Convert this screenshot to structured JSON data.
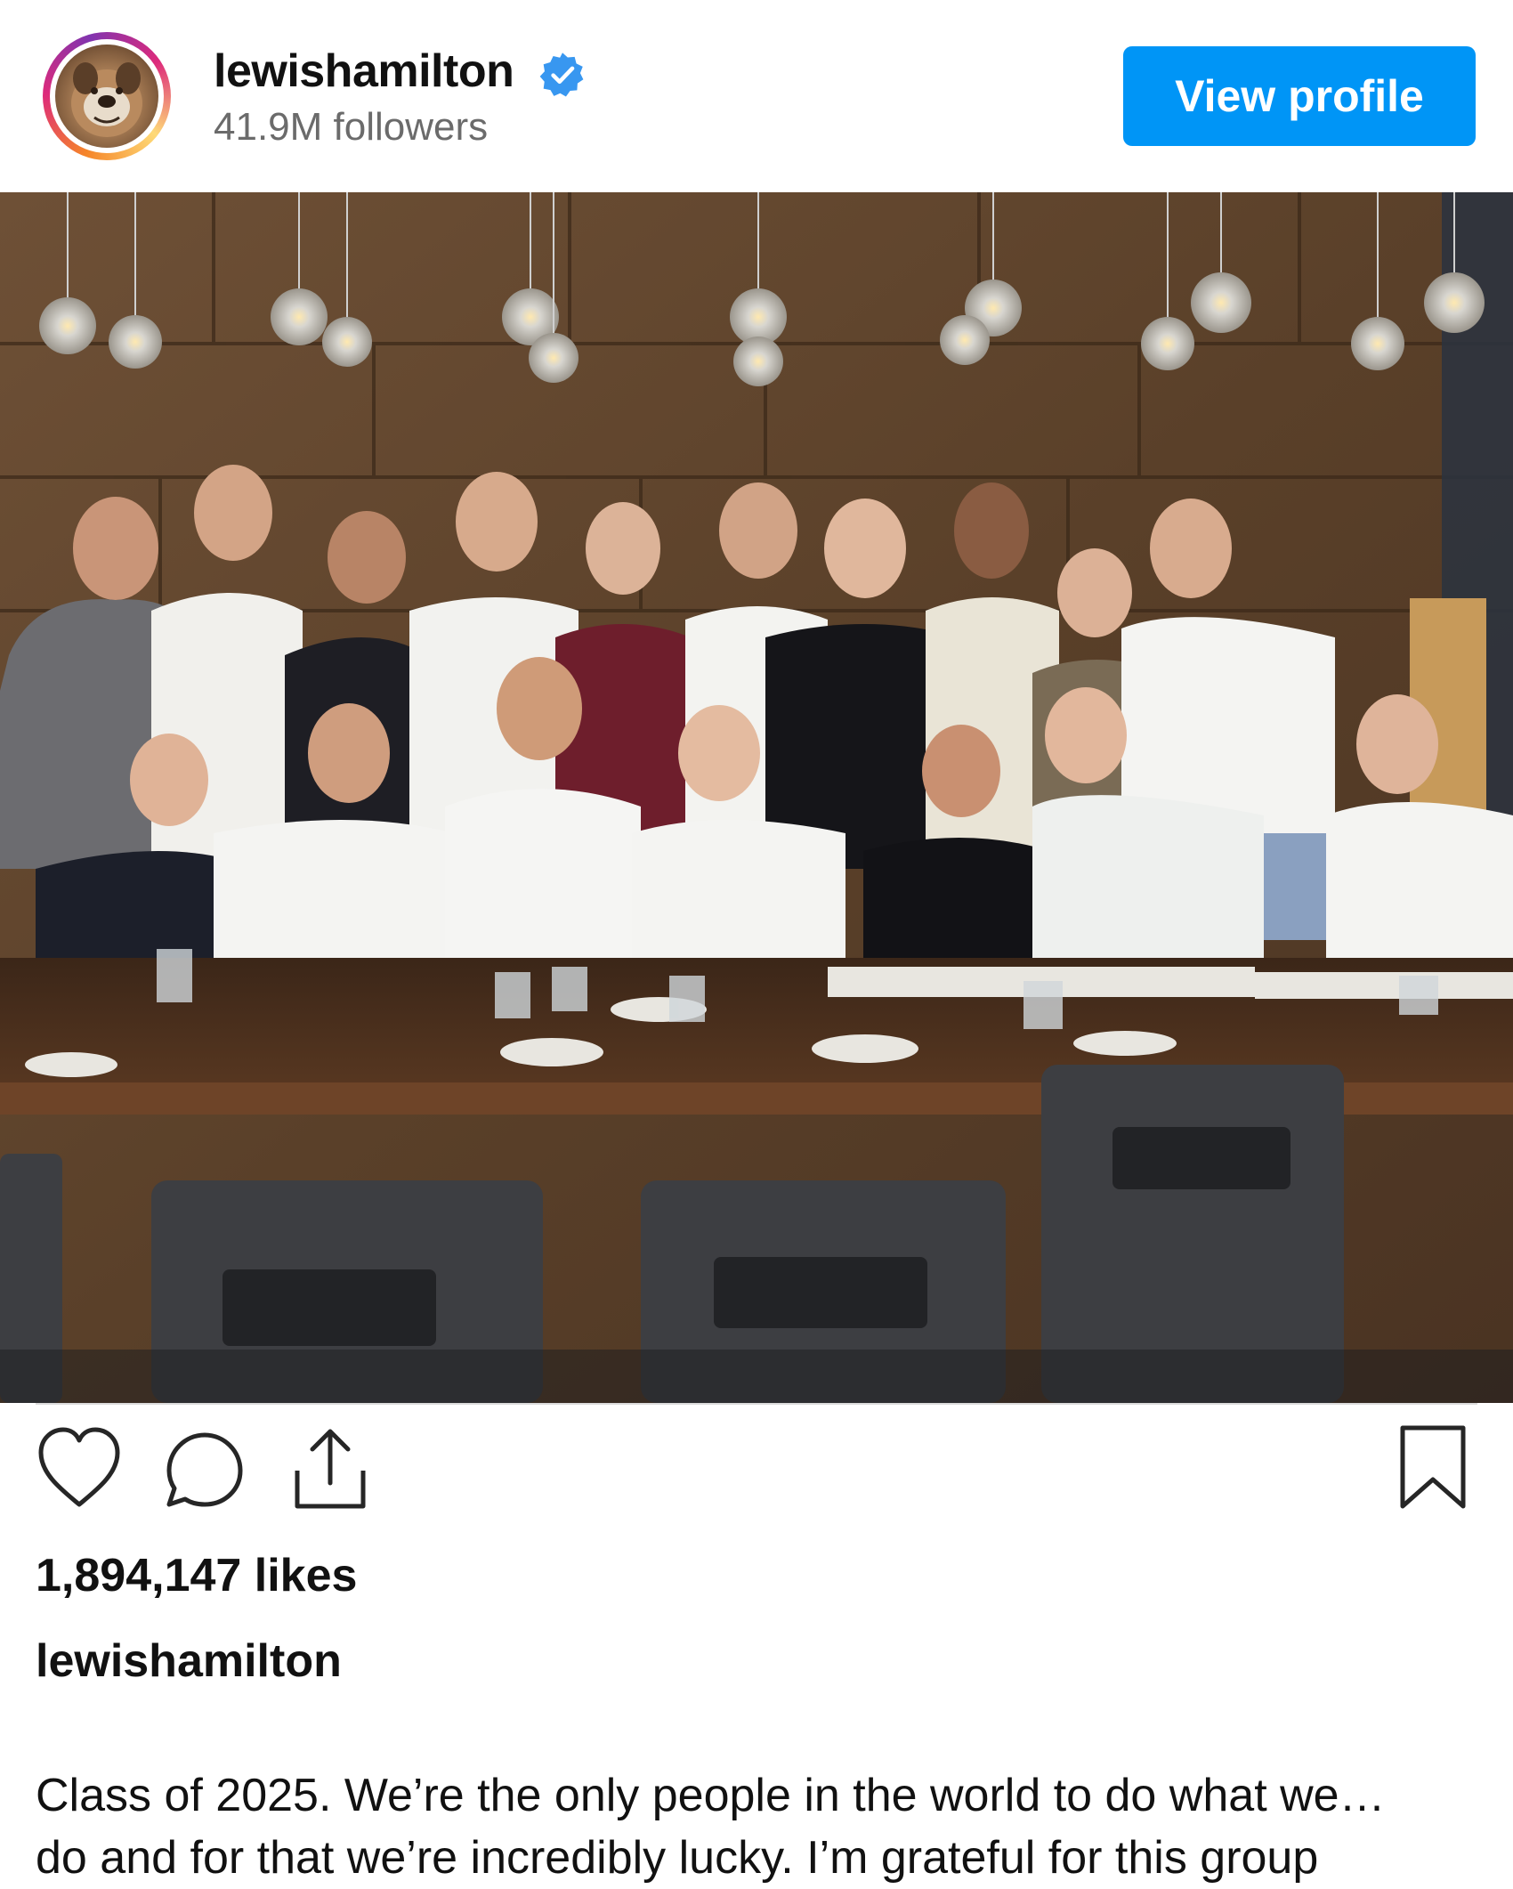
{
  "post_header": {
    "username": "lewishamilton",
    "followers": "41.9M followers",
    "verified_icon": "verified-badge-icon",
    "view_profile_label": "View profile"
  },
  "photo": {
    "description_icon": "group-photo"
  },
  "actions": {
    "like_icon": "heart-icon",
    "comment_icon": "comment-icon",
    "share_icon": "share-icon",
    "save_icon": "bookmark-icon"
  },
  "likes": "1,894,147 likes",
  "caption": {
    "username": "lewishamilton",
    "line1": "Class of 2025. We’re the only people in the world to do what we…",
    "line2": "do and for that we’re incredibly lucky. I’m grateful for this group"
  },
  "colors": {
    "accent": "#0095f6",
    "verified": "#3897f0",
    "muted_text": "#6b6b6b"
  }
}
